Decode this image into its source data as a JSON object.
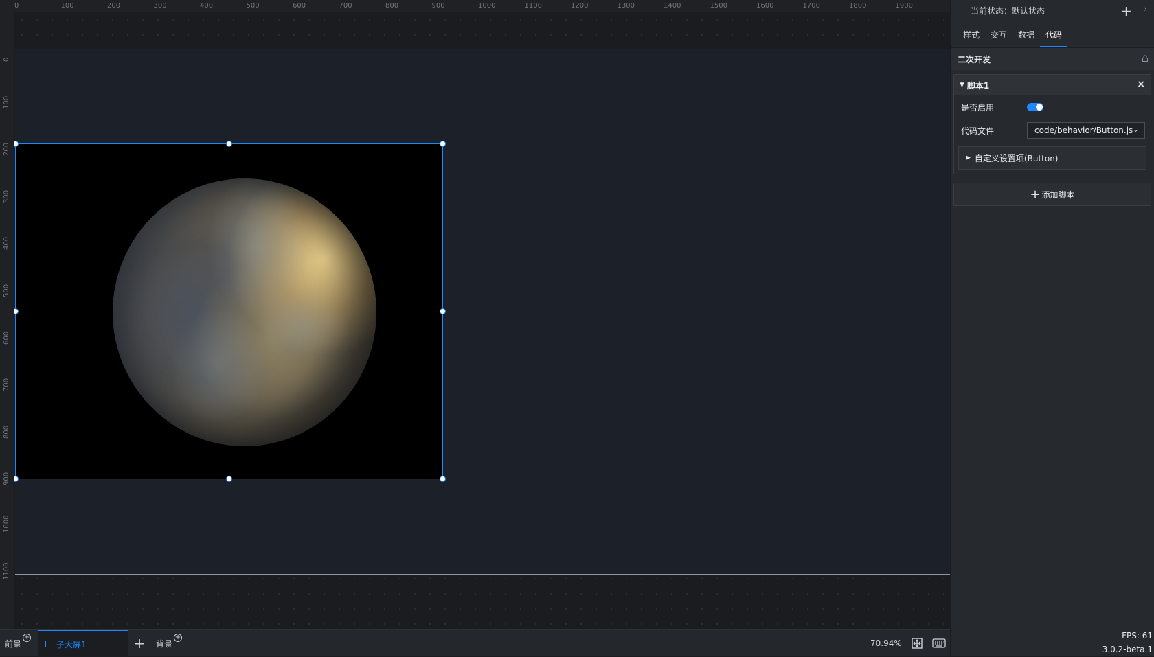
{
  "canvas": {
    "ruler_top_labels": [
      "0",
      "100",
      "200",
      "300",
      "400",
      "500",
      "600",
      "700",
      "800",
      "900",
      "1000",
      "1100",
      "1200",
      "1300",
      "1400",
      "1500",
      "1600",
      "1700",
      "1800",
      "1900"
    ],
    "ruler_left_labels": [
      "0",
      "100",
      "200",
      "300",
      "400",
      "500",
      "600",
      "700",
      "800",
      "900",
      "1000",
      "1100"
    ]
  },
  "bottom_bar": {
    "foreground_label": "前景",
    "active_tab_label": "子大屏1",
    "background_label": "背景",
    "zoom": "70.94%"
  },
  "panel": {
    "current_state_label": "当前状态：默认状态",
    "tabs": [
      {
        "label": "样式"
      },
      {
        "label": "交互"
      },
      {
        "label": "数据"
      },
      {
        "label": "代码"
      }
    ],
    "active_tab": "代码",
    "section_title": "二次开发",
    "script": {
      "title": "脚本1",
      "enabled_label": "是否启用",
      "enabled": true,
      "code_file_label": "代码文件",
      "code_file_value": "code/behavior/Button.js",
      "custom_settings_label": "自定义设置项(Button)"
    },
    "add_script_label": "添加脚本",
    "fps": "FPS: 61",
    "version": "3.0.2-beta.1"
  }
}
